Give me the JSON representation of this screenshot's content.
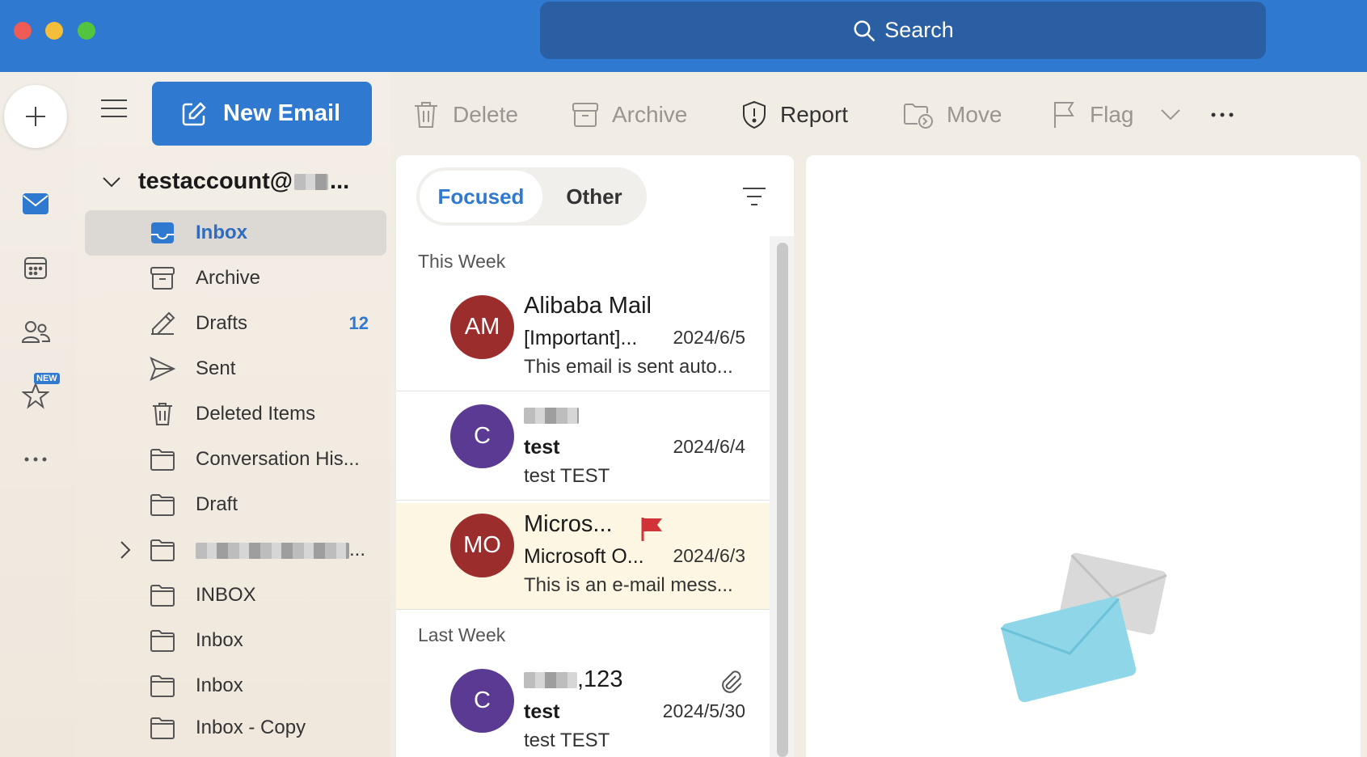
{
  "search": {
    "label": "Search"
  },
  "rail": {
    "new_badge": "NEW"
  },
  "toolbar": {
    "new_email": "New Email",
    "delete": "Delete",
    "archive": "Archive",
    "report": "Report",
    "move": "Move",
    "flag": "Flag"
  },
  "account": {
    "name": "testaccount@",
    "suffix": "..."
  },
  "folders": [
    {
      "label": "Inbox",
      "count": ""
    },
    {
      "label": "Archive",
      "count": ""
    },
    {
      "label": "Drafts",
      "count": "12"
    },
    {
      "label": "Sent",
      "count": ""
    },
    {
      "label": "Deleted Items",
      "count": ""
    },
    {
      "label": "Conversation His...",
      "count": ""
    },
    {
      "label": "Draft",
      "count": ""
    },
    {
      "label": "...",
      "count": ""
    },
    {
      "label": "INBOX",
      "count": ""
    },
    {
      "label": "Inbox",
      "count": ""
    },
    {
      "label": "Inbox",
      "count": ""
    },
    {
      "label": "Inbox - Copy",
      "count": ""
    }
  ],
  "tabs": {
    "focused": "Focused",
    "other": "Other"
  },
  "groups": {
    "this_week": "This Week",
    "last_week": "Last Week"
  },
  "messages": [
    {
      "initials": "AM",
      "avatar_color": "#9b2d2d",
      "sender": "Alibaba Mail",
      "subject": "[Important]...",
      "date": "2024/6/5",
      "preview": "This email is sent auto..."
    },
    {
      "initials": "C",
      "avatar_color": "#5b3a93",
      "sender": "",
      "subject": "test",
      "date": "2024/6/4",
      "preview": "test TEST"
    },
    {
      "initials": "MO",
      "avatar_color": "#9b2d2d",
      "sender": "Micros...",
      "subject": "Microsoft O...",
      "date": "2024/6/3",
      "preview": "This is an e-mail mess..."
    },
    {
      "initials": "C",
      "avatar_color": "#5b3a93",
      "sender": ",123",
      "subject": "test",
      "date": "2024/5/30",
      "preview": "test TEST"
    }
  ],
  "colors": {
    "accent": "#2f79d0",
    "flag": "#d13438"
  }
}
